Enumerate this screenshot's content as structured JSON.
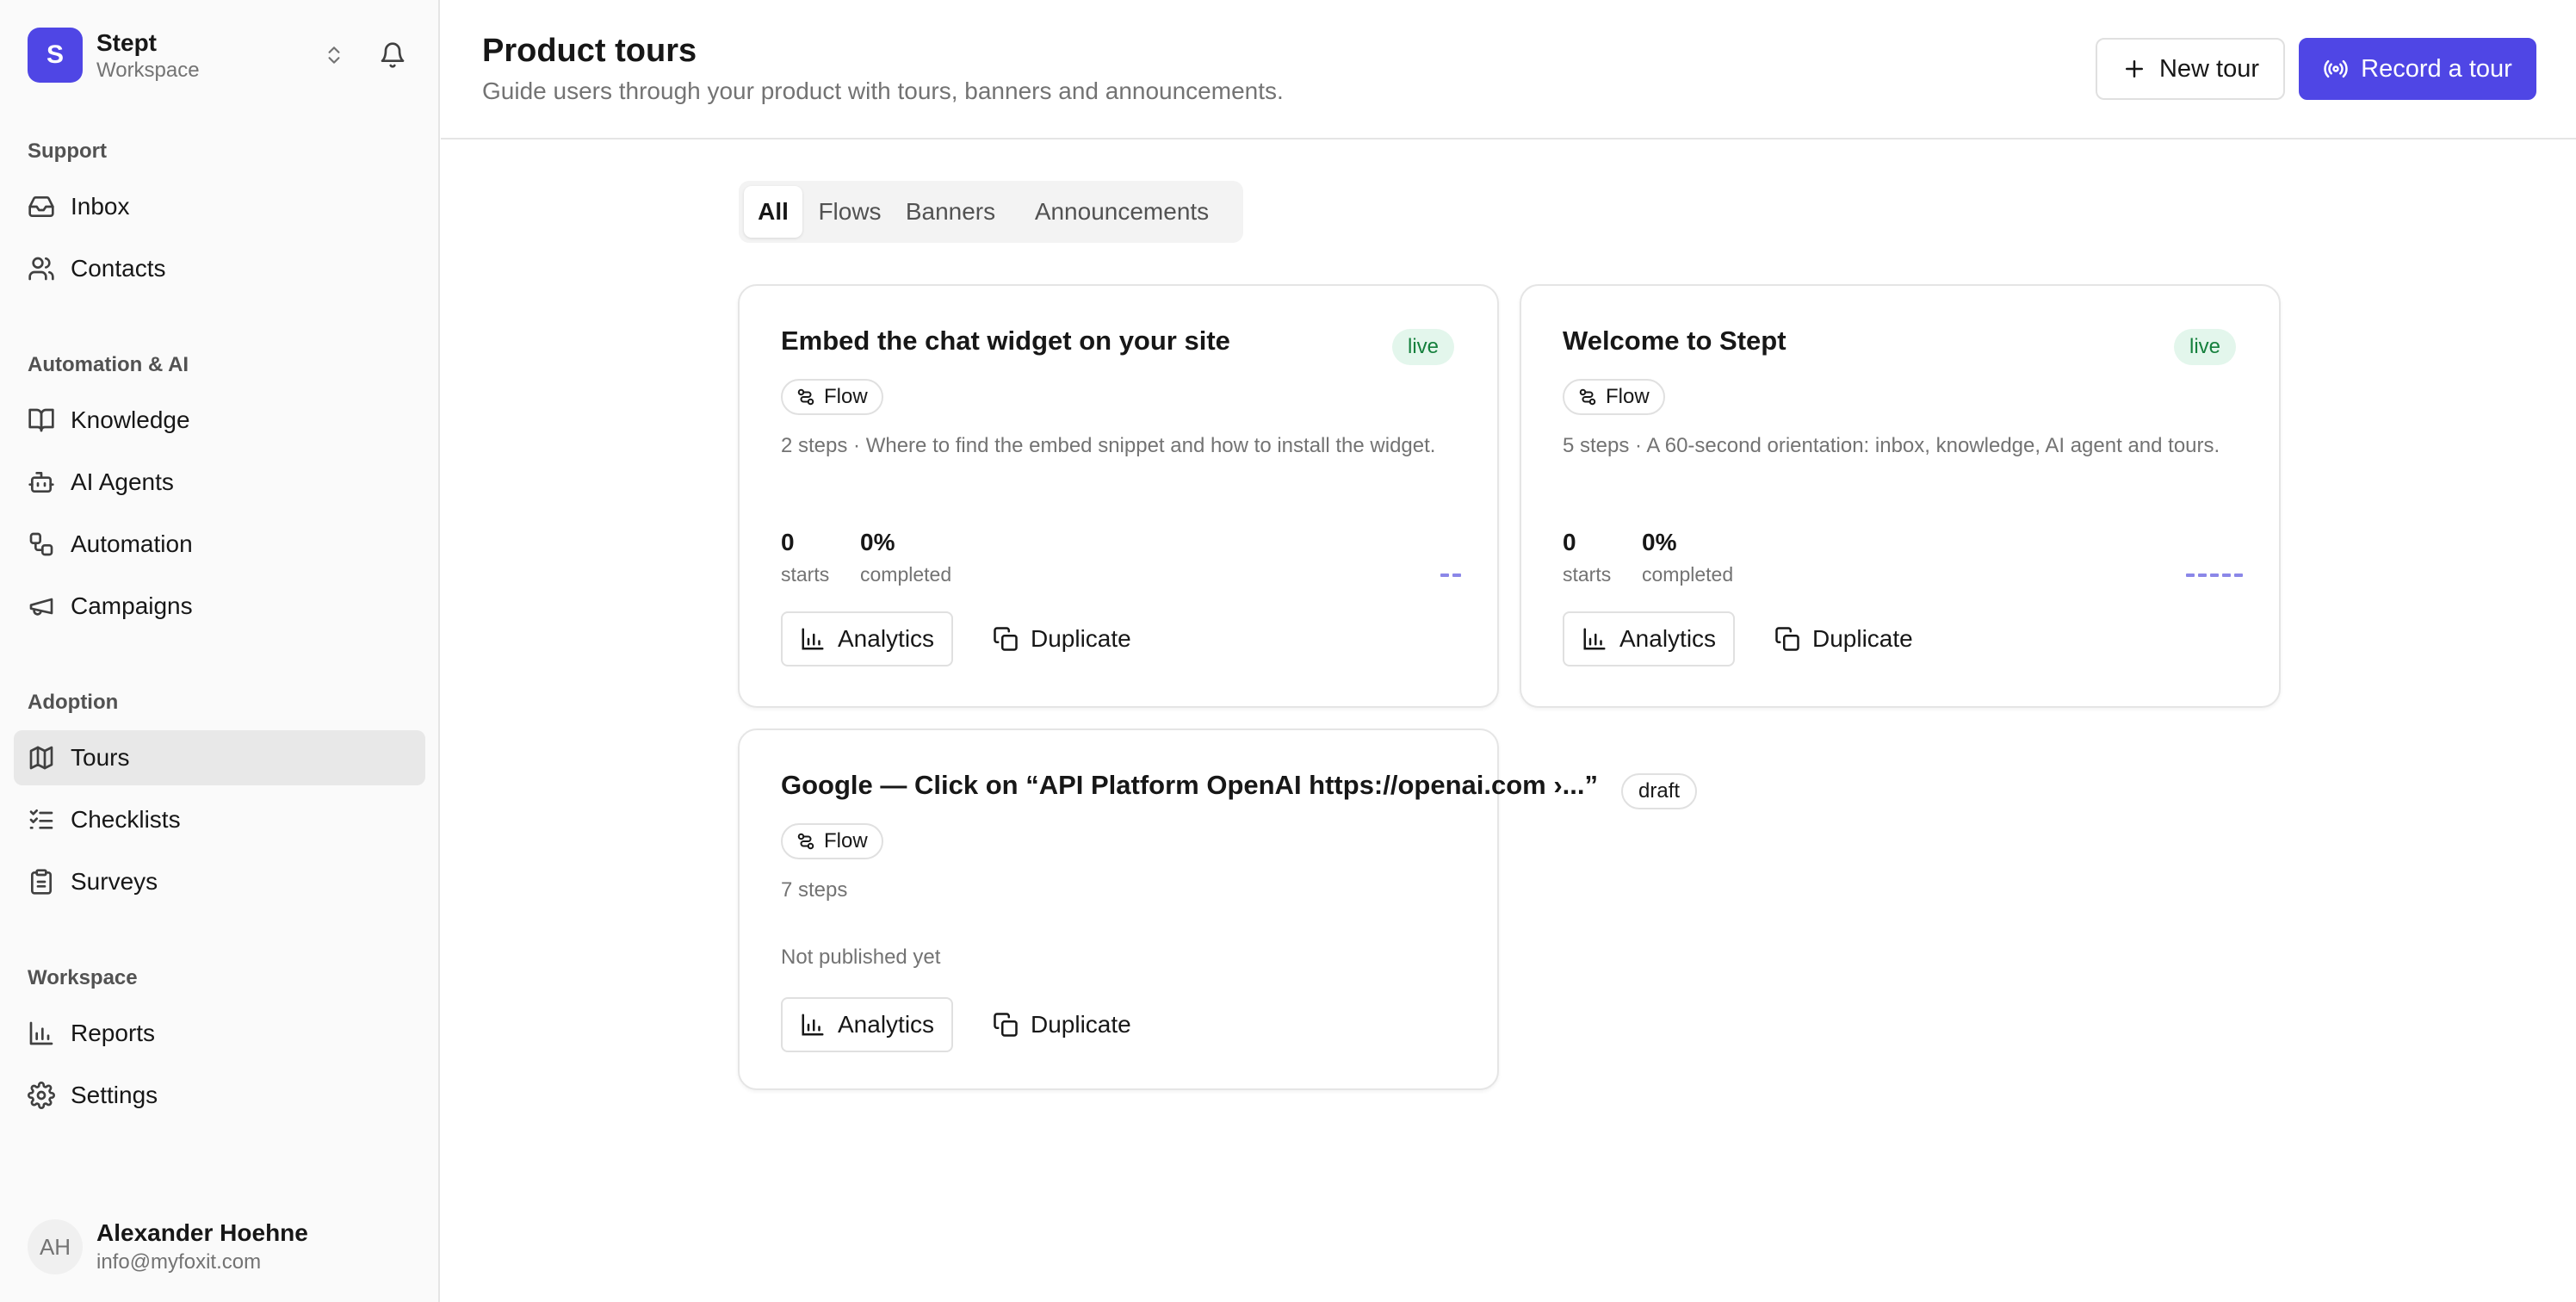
{
  "workspace": {
    "initial": "S",
    "name": "Stept",
    "subtitle": "Workspace"
  },
  "sidebar": {
    "sections": [
      {
        "label": "Support",
        "items": [
          {
            "label": "Inbox",
            "icon": "inbox-icon"
          },
          {
            "label": "Contacts",
            "icon": "users-icon"
          }
        ]
      },
      {
        "label": "Automation & AI",
        "items": [
          {
            "label": "Knowledge",
            "icon": "book-icon"
          },
          {
            "label": "AI Agents",
            "icon": "bot-icon"
          },
          {
            "label": "Automation",
            "icon": "workflow-icon"
          },
          {
            "label": "Campaigns",
            "icon": "megaphone-icon"
          }
        ]
      },
      {
        "label": "Adoption",
        "items": [
          {
            "label": "Tours",
            "icon": "map-icon",
            "active": true
          },
          {
            "label": "Checklists",
            "icon": "checklist-icon"
          },
          {
            "label": "Surveys",
            "icon": "clipboard-icon"
          }
        ]
      },
      {
        "label": "Workspace",
        "items": [
          {
            "label": "Reports",
            "icon": "bar-chart-icon"
          },
          {
            "label": "Settings",
            "icon": "gear-icon"
          }
        ]
      }
    ]
  },
  "user": {
    "initials": "AH",
    "name": "Alexander Hoehne",
    "email": "info@myfoxit.com"
  },
  "header": {
    "title": "Product tours",
    "subtitle": "Guide users through your product with tours, banners and announcements.",
    "new_tour_label": "New tour",
    "record_tour_label": "Record a tour"
  },
  "tabs": [
    {
      "label": "All",
      "active": true
    },
    {
      "label": "Flows"
    },
    {
      "label": "Banners"
    },
    {
      "label": "Announcements"
    }
  ],
  "tours": [
    {
      "title": "Embed the chat widget on your site",
      "status": "live",
      "type": "Flow",
      "description": "2 steps · Where to find the embed snippet and how to install the widget.",
      "starts": "0",
      "starts_label": "starts",
      "completed": "0%",
      "completed_label": "completed",
      "steps": 2,
      "analytics_label": "Analytics",
      "duplicate_label": "Duplicate"
    },
    {
      "title": "Welcome to Stept",
      "status": "live",
      "type": "Flow",
      "description": "5 steps · A 60-second orientation: inbox, knowledge, AI agent and tours.",
      "starts": "0",
      "starts_label": "starts",
      "completed": "0%",
      "completed_label": "completed",
      "steps": 5,
      "analytics_label": "Analytics",
      "duplicate_label": "Duplicate"
    },
    {
      "title": "Google — Click on “API Platform OpenAI https://openai.com ›...”",
      "status": "draft",
      "type": "Flow",
      "description": "7 steps",
      "note": "Not published yet",
      "analytics_label": "Analytics",
      "duplicate_label": "Duplicate"
    }
  ],
  "colors": {
    "accent": "#4f46e5",
    "live_bg": "#e3f6ec",
    "live_text": "#15803d",
    "spark": "#8b87e8"
  }
}
